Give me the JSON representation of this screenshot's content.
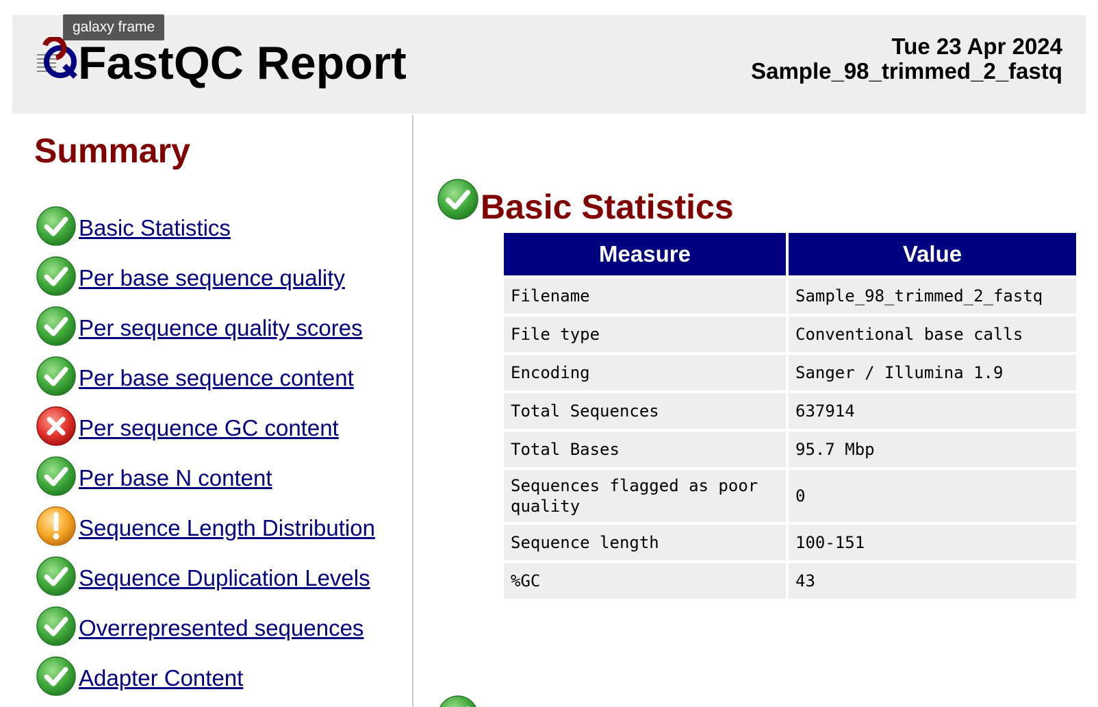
{
  "tooltip": "galaxy frame",
  "header": {
    "title": "FastQC Report",
    "date": "Tue 23 Apr 2024",
    "filename": "Sample_98_trimmed_2_fastq",
    "logo_icon": "fastqc-logo-icon"
  },
  "summary": {
    "title": "Summary",
    "items": [
      {
        "label": "Basic Statistics",
        "status": "pass"
      },
      {
        "label": "Per base sequence quality",
        "status": "pass"
      },
      {
        "label": "Per sequence quality scores",
        "status": "pass"
      },
      {
        "label": "Per base sequence content",
        "status": "pass"
      },
      {
        "label": "Per sequence GC content",
        "status": "fail"
      },
      {
        "label": "Per base N content",
        "status": "pass"
      },
      {
        "label": "Sequence Length Distribution",
        "status": "warn"
      },
      {
        "label": "Sequence Duplication Levels",
        "status": "pass"
      },
      {
        "label": "Overrepresented sequences",
        "status": "pass"
      },
      {
        "label": "Adapter Content",
        "status": "pass"
      }
    ]
  },
  "basic_stats": {
    "title": "Basic Statistics",
    "status": "pass",
    "headers": {
      "measure": "Measure",
      "value": "Value"
    },
    "rows": [
      {
        "measure": "Filename",
        "value": "Sample_98_trimmed_2_fastq"
      },
      {
        "measure": "File type",
        "value": "Conventional base calls"
      },
      {
        "measure": "Encoding",
        "value": "Sanger / Illumina 1.9"
      },
      {
        "measure": "Total Sequences",
        "value": "637914"
      },
      {
        "measure": "Total Bases",
        "value": "95.7 Mbp"
      },
      {
        "measure": "Sequences flagged as poor quality",
        "value": "0"
      },
      {
        "measure": "Sequence length",
        "value": "100-151"
      },
      {
        "measure": "%GC",
        "value": "43"
      }
    ]
  },
  "colors": {
    "heading": "#800000",
    "link": "#000080",
    "table_header": "#000080",
    "pass": "#4caf50",
    "fail": "#e53935",
    "warn": "#f5a623"
  }
}
